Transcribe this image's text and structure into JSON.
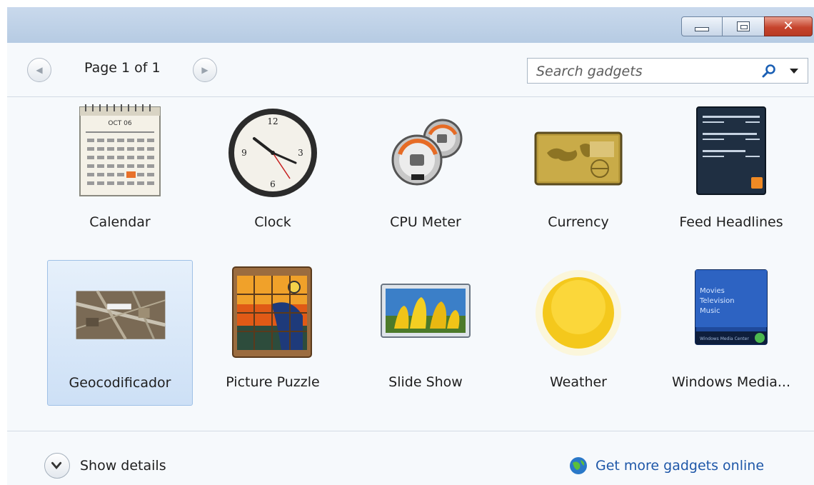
{
  "window": {
    "caption_buttons": {
      "minimize_icon": "minimize-icon",
      "maximize_icon": "maximize-icon",
      "close_icon": "close-icon"
    }
  },
  "toolbar": {
    "page_label": "Page 1 of 1",
    "prev_icon": "chevron-left-icon",
    "next_icon": "chevron-right-icon",
    "search_placeholder": "Search gadgets",
    "search_icon": "search-icon",
    "search_dropdown_icon": "chevron-down-icon"
  },
  "gadgets": [
    {
      "name": "Calendar",
      "icon": "calendar-icon",
      "selected": false
    },
    {
      "name": "Clock",
      "icon": "clock-icon",
      "selected": false
    },
    {
      "name": "CPU Meter",
      "icon": "cpu-meter-icon",
      "selected": false
    },
    {
      "name": "Currency",
      "icon": "currency-icon",
      "selected": false
    },
    {
      "name": "Feed Headlines",
      "icon": "feed-headlines-icon",
      "selected": false
    },
    {
      "name": "Geocodificador",
      "icon": "map-icon",
      "selected": true
    },
    {
      "name": "Picture Puzzle",
      "icon": "picture-puzzle-icon",
      "selected": false
    },
    {
      "name": "Slide Show",
      "icon": "slide-show-icon",
      "selected": false
    },
    {
      "name": "Weather",
      "icon": "weather-sun-icon",
      "selected": false
    },
    {
      "name": "Windows Media...",
      "icon": "windows-media-center-icon",
      "selected": false
    }
  ],
  "calendar_art": {
    "month": "OCT 06"
  },
  "media_center_art": {
    "lines": [
      "Movies",
      "Television",
      "Music"
    ],
    "brand": "Windows Media Center"
  },
  "footer": {
    "details_label": "Show details",
    "details_icon": "chevron-down-circle-icon",
    "online_label": "Get more gadgets online",
    "online_icon": "globe-icon"
  },
  "colors": {
    "link": "#1e57a8",
    "selection": "#cde0f6",
    "titlebar": "#b8cde4"
  }
}
